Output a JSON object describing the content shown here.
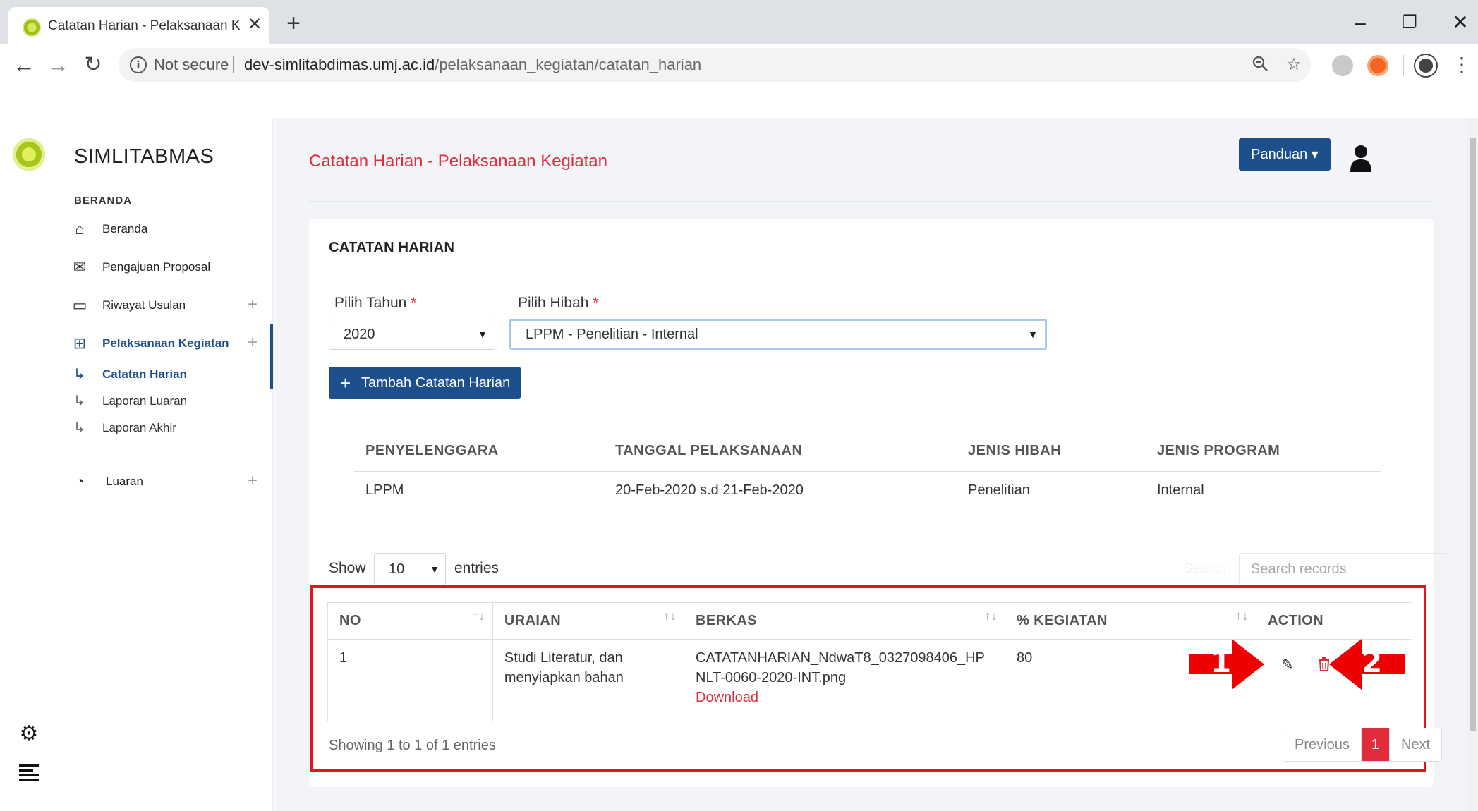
{
  "browser": {
    "tab_title": "Catatan Harian - Pelaksanaan Ke",
    "not_secure": "Not secure",
    "url_host": "dev-simlitabdimas.umj.ac.id",
    "url_path": "/pelaksanaan_kegiatan/catatan_harian"
  },
  "sidebar": {
    "brand": "SIMLITABMAS",
    "section": "BERANDA",
    "items": [
      {
        "label": "Beranda",
        "icon": "home-icon"
      },
      {
        "label": "Pengajuan Proposal",
        "icon": "envelope-icon"
      },
      {
        "label": "Riwayat Usulan",
        "icon": "card-icon"
      },
      {
        "label": "Pelaksanaan Kegiatan",
        "icon": "briefcase-icon"
      },
      {
        "label": "Luaran",
        "icon": "clock-icon"
      }
    ],
    "subitems": [
      {
        "label": "Catatan Harian"
      },
      {
        "label": "Laporan Luaran"
      },
      {
        "label": "Laporan Akhir"
      }
    ]
  },
  "header": {
    "page_title": "Catatan Harian - Pelaksanaan Kegiatan",
    "panduan": "Panduan"
  },
  "card": {
    "title": "CATATAN HARIAN",
    "tahun_label": "Pilih Tahun",
    "hibah_label": "Pilih Hibah",
    "required_mark": "*",
    "tahun_value": "2020",
    "hibah_value": "LPPM - Penelitian - Internal",
    "add_button": "Tambah Catatan Harian"
  },
  "info": {
    "headers": [
      "PENYELENGGARA",
      "TANGGAL PELAKSANAAN",
      "JENIS HIBAH",
      "JENIS PROGRAM"
    ],
    "values": [
      "LPPM",
      "20-Feb-2020 s.d 21-Feb-2020",
      "Penelitian",
      "Internal"
    ]
  },
  "table": {
    "show_label": "Show",
    "entries_label": "entries",
    "page_length": "10",
    "search_label": "Search:",
    "search_placeholder": "Search records",
    "headers": [
      "NO",
      "URAIAN",
      "BERKAS",
      "% KEGIATAN",
      "ACTION"
    ],
    "rows": [
      {
        "no": "1",
        "uraian": "Studi Literatur, dan menyiapkan bahan",
        "berkas": "CATATANHARIAN_NdwaT8_0327098406_HPNLT-0060-2020-INT.png",
        "download": "Download",
        "kegiatan": "80"
      }
    ],
    "info": "Showing 1 to 1 of 1 entries",
    "prev": "Previous",
    "page": "1",
    "next": "Next"
  },
  "annotations": {
    "arrow1": "1",
    "arrow2": "2"
  },
  "colors": {
    "primary": "#1c4f8c",
    "accent_red": "#e02d3c",
    "highlight_frame": "#e8121c"
  }
}
